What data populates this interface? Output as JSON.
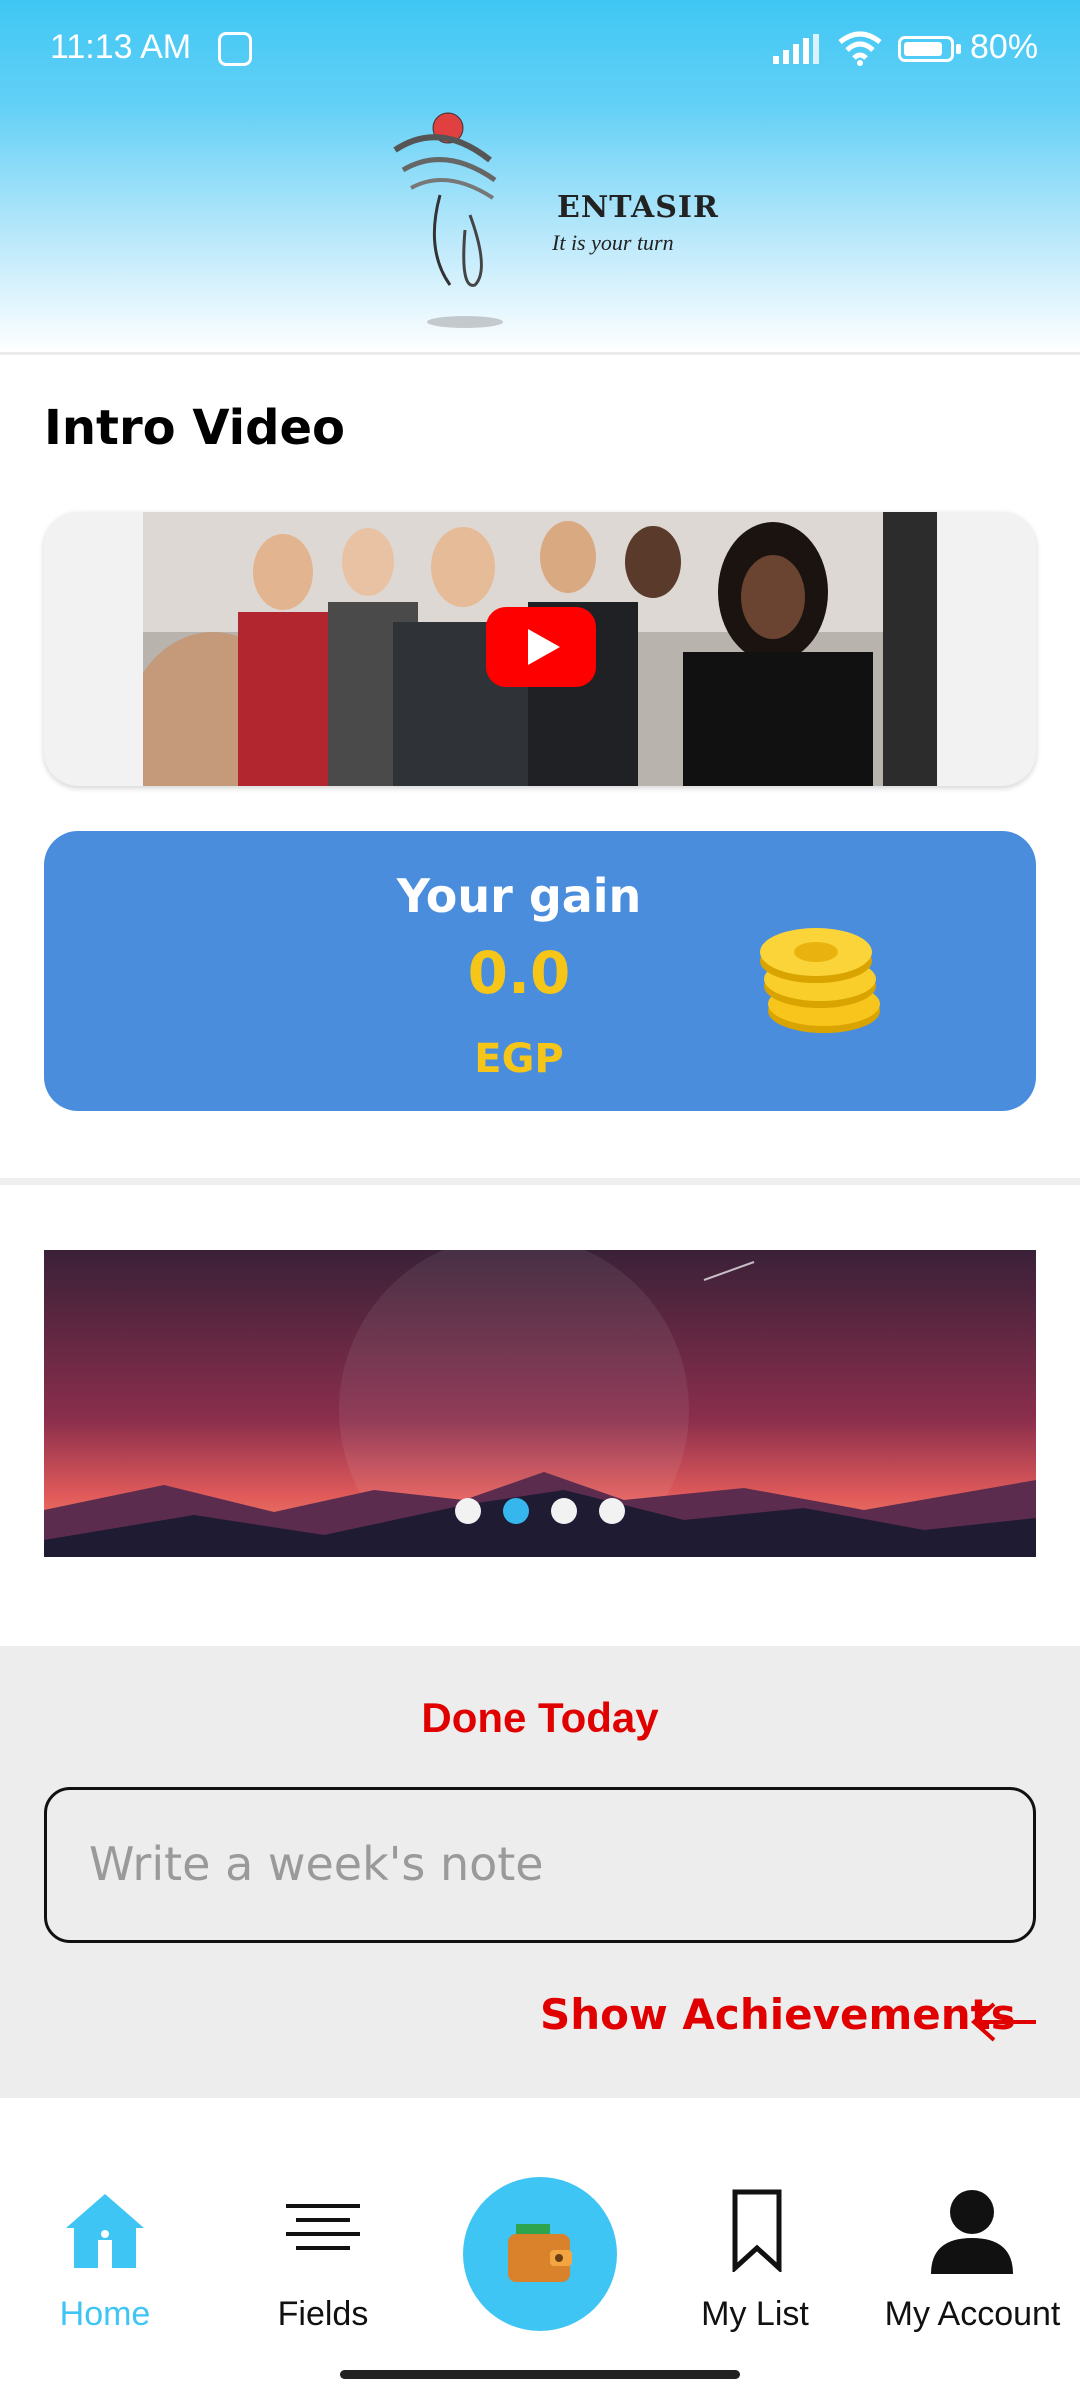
{
  "status_bar": {
    "time": "11:13 AM",
    "battery": "80%"
  },
  "brand": {
    "name": "ENTASIR",
    "tagline": "It is your turn"
  },
  "intro": {
    "title": "Intro Video"
  },
  "gain": {
    "label": "Your gain",
    "value": "0.0",
    "currency": "EGP"
  },
  "banner": {
    "slides_count": 4,
    "active_slide": 2
  },
  "done_today": {
    "title": "Done Today",
    "note_placeholder": "Write a week's note",
    "show_achievements": "Show Achievements"
  },
  "nav": {
    "home": "Home",
    "fields": "Fields",
    "my_list": "My List",
    "my_account": "My Account",
    "active": "home"
  },
  "colors": {
    "header": "#3fc7f4",
    "gain_card": "#4a8ddd",
    "gain_value": "#f5c518",
    "accent_red": "#e00000",
    "active_nav": "#3fc5f4"
  }
}
